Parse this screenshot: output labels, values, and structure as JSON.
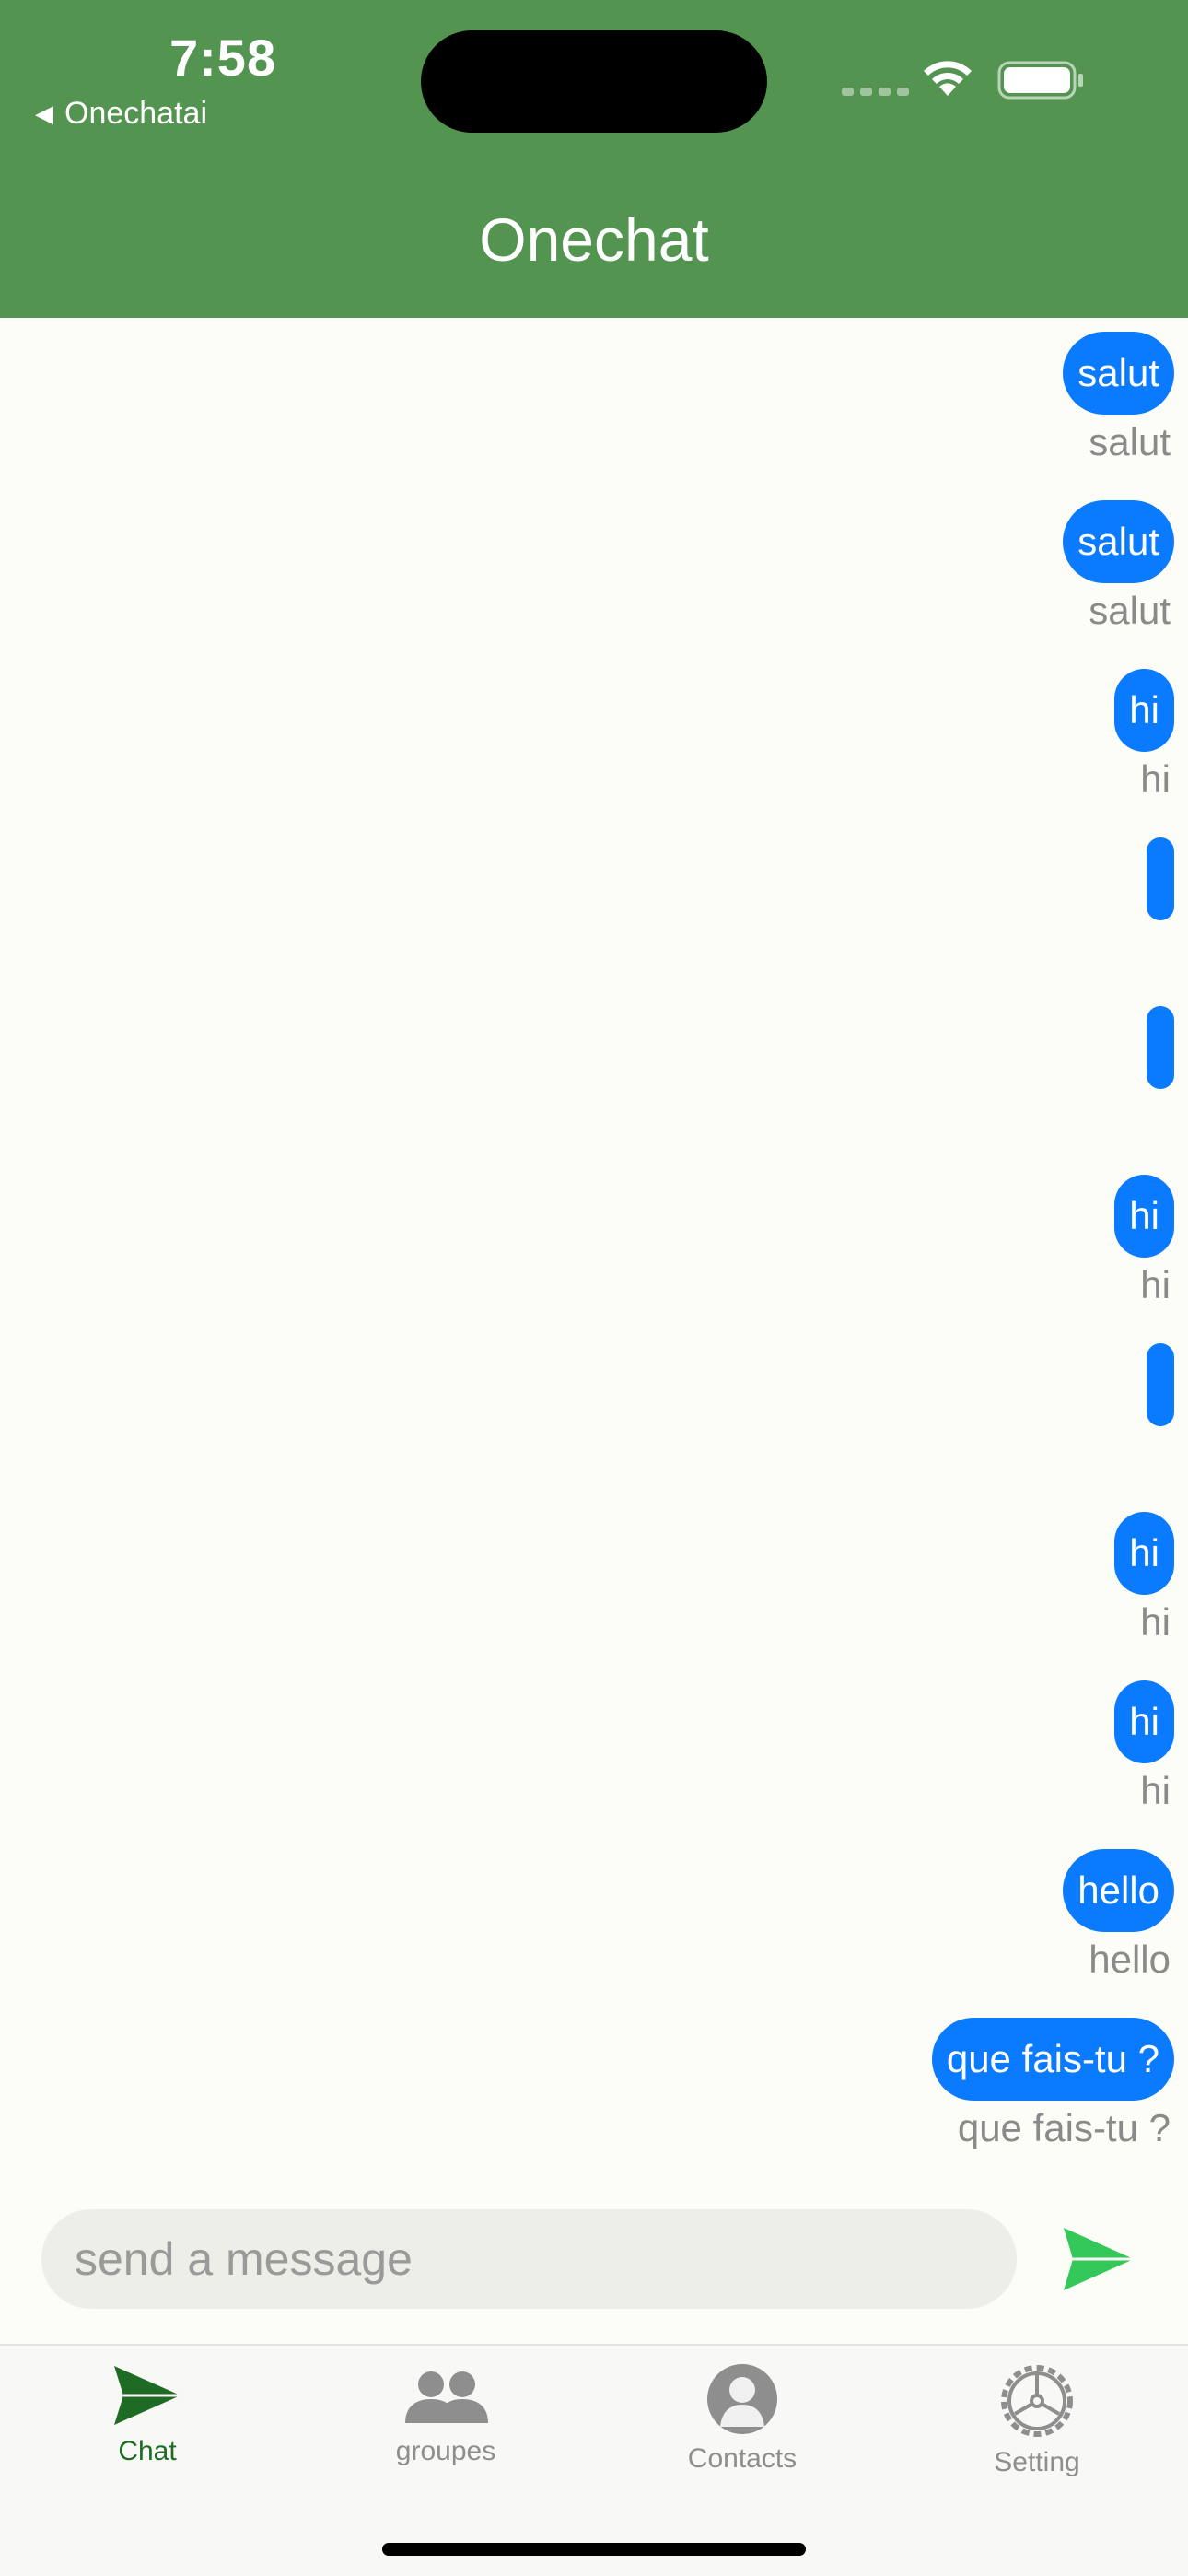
{
  "status": {
    "time": "7:58",
    "back_label": "Onechatai"
  },
  "header": {
    "title": "Onechat"
  },
  "messages": [
    {
      "text": "salut",
      "caption": "salut"
    },
    {
      "text": "salut",
      "caption": "salut"
    },
    {
      "text": "hi",
      "caption": "hi"
    },
    {
      "text": "",
      "caption": ""
    },
    {
      "text": "",
      "caption": ""
    },
    {
      "text": "hi",
      "caption": "hi"
    },
    {
      "text": "",
      "caption": ""
    },
    {
      "text": "hi",
      "caption": "hi"
    },
    {
      "text": "hi",
      "caption": "hi"
    },
    {
      "text": "hello",
      "caption": "hello"
    },
    {
      "text": "que fais-tu ?",
      "caption": "que fais-tu ?"
    }
  ],
  "composer": {
    "placeholder": "send a message",
    "value": ""
  },
  "tabs": [
    {
      "label": "Chat",
      "icon": "send-icon",
      "active": true
    },
    {
      "label": "groupes",
      "icon": "group-icon",
      "active": false
    },
    {
      "label": "Contacts",
      "icon": "contact-icon",
      "active": false
    },
    {
      "label": "Setting",
      "icon": "gear-icon",
      "active": false
    }
  ],
  "colors": {
    "header": "#529450",
    "bubble": "#0a7aff",
    "send": "#34c759",
    "tab_active": "#1e6b24",
    "tab_inactive": "#8e8e8e"
  }
}
